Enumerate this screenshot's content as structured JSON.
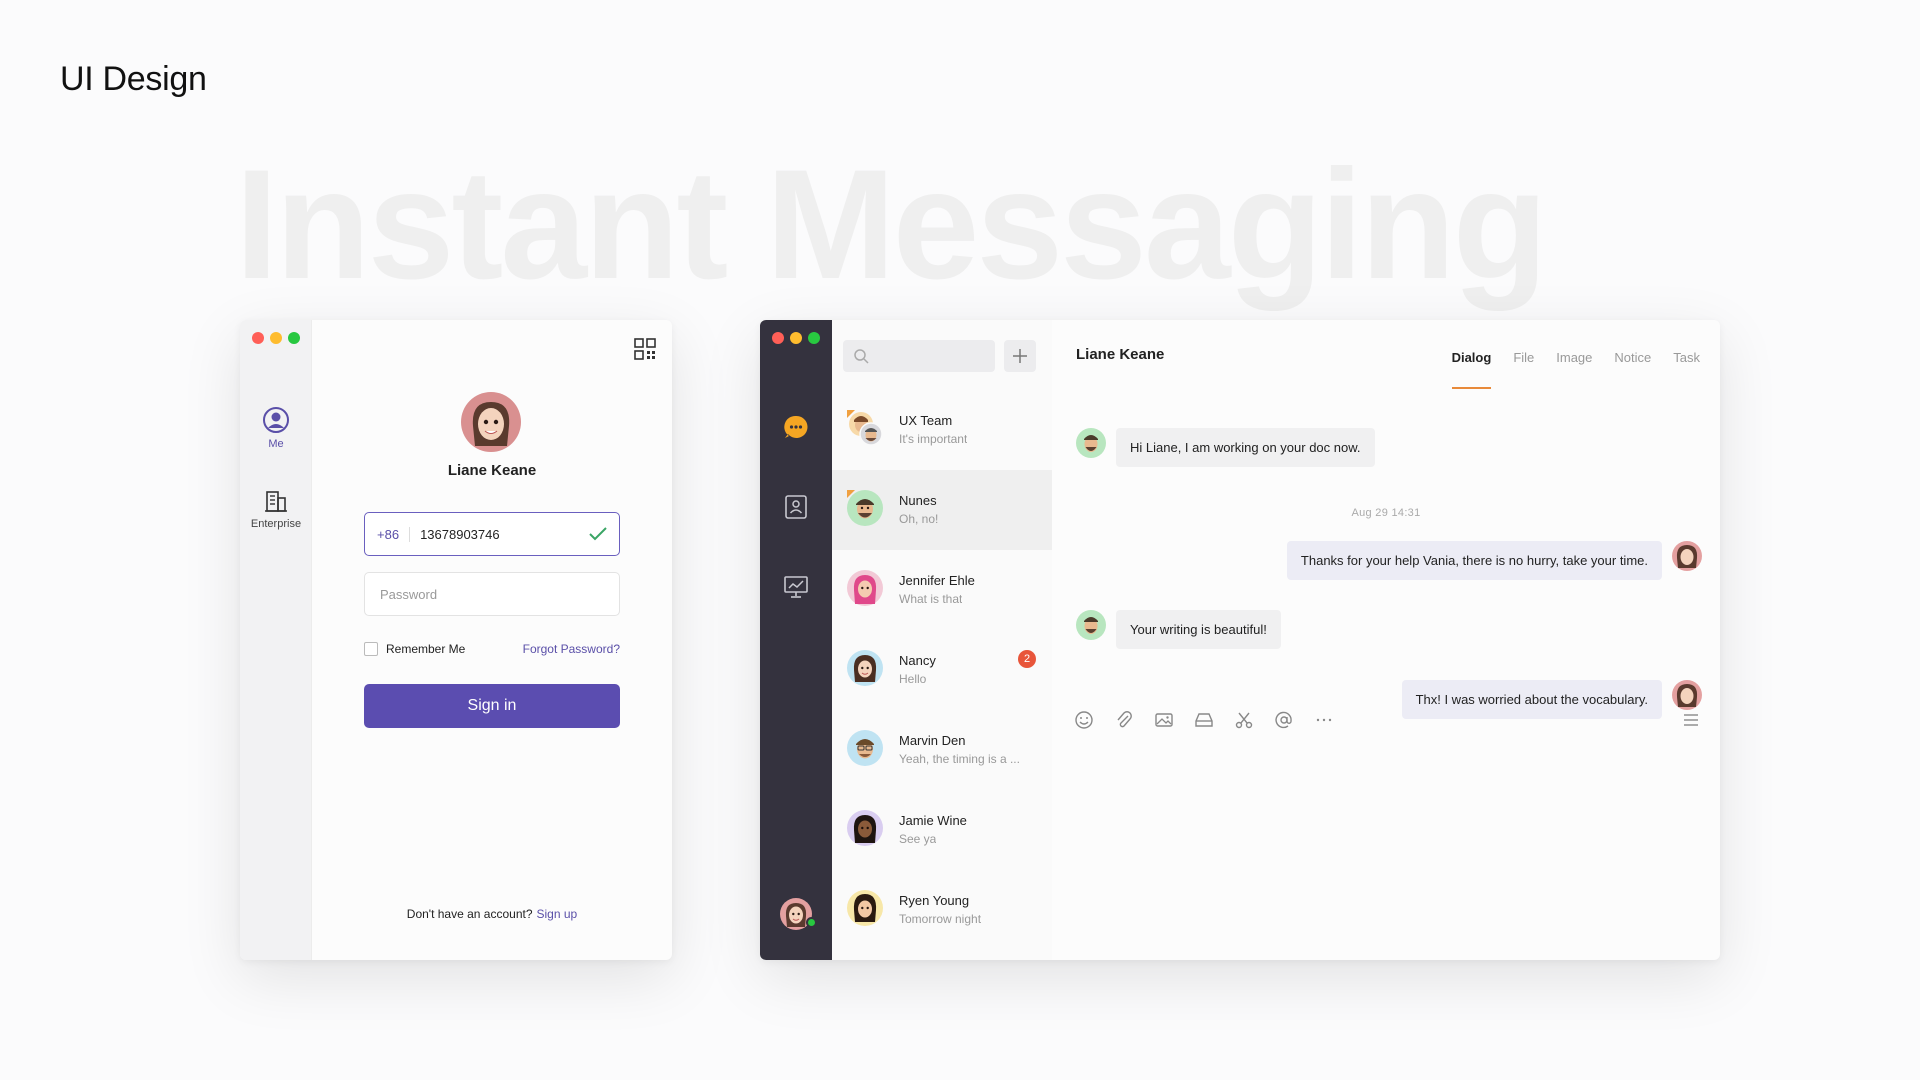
{
  "page": {
    "label": "UI Design",
    "hero_title": "Instant Messaging"
  },
  "login": {
    "nav": [
      {
        "label": "Me",
        "icon": "user-circle-icon"
      },
      {
        "label": "Enterprise",
        "icon": "building-icon"
      }
    ],
    "user_name": "Liane Keane",
    "country_code": "+86",
    "phone": "13678903746",
    "password_placeholder": "Password",
    "remember_label": "Remember Me",
    "forgot_label": "Forgot Password?",
    "signin_label": "Sign in",
    "signup_prompt": "Don't have an account?",
    "signup_link": "Sign up"
  },
  "chat": {
    "conversations": [
      {
        "name": "UX Team",
        "preview": "It's important"
      },
      {
        "name": "Nunes",
        "preview": "Oh, no!"
      },
      {
        "name": "Jennifer Ehle",
        "preview": "What is that"
      },
      {
        "name": "Nancy",
        "preview": "Hello",
        "badge": "2"
      },
      {
        "name": "Marvin Den",
        "preview": "Yeah, the timing is a ..."
      },
      {
        "name": "Jamie Wine",
        "preview": "See ya"
      },
      {
        "name": "Ryen Young",
        "preview": "Tomorrow night"
      }
    ],
    "contact_name": "Liane Keane",
    "tabs": [
      "Dialog",
      "File",
      "Image",
      "Notice",
      "Task"
    ],
    "active_tab": "Dialog",
    "messages": [
      {
        "from": "them",
        "text": "Hi Liane, I am working on your doc now."
      },
      {
        "from": "me",
        "text": "Thanks for your help Vania, there is no hurry, take your time."
      },
      {
        "from": "them",
        "text": "Your writing is beautiful!"
      },
      {
        "from": "me",
        "text": "Thx! I was worried about the vocabulary."
      }
    ],
    "timestamp": "Aug 29   14:31",
    "toolbar_icons": [
      "emoji-icon",
      "attachment-icon",
      "image-icon",
      "folder-icon",
      "scissors-icon",
      "at-icon",
      "more-icon"
    ]
  },
  "colors": {
    "accent": "#5b4db0",
    "rail": "#34323e",
    "tab_underline": "#e88a3a",
    "badge": "#e8553a",
    "online": "#28c840"
  }
}
